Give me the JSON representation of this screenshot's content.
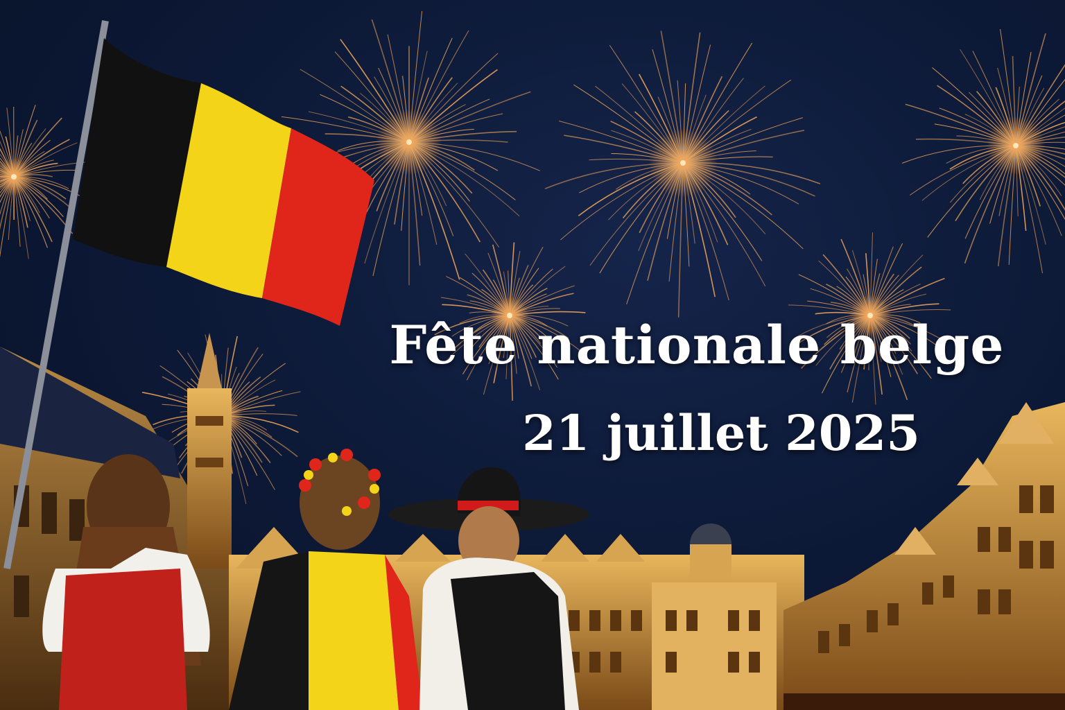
{
  "headline": {
    "title": "Fête nationale belge",
    "date": "21 juillet 2025"
  },
  "colors": {
    "sky": "#0d1a38",
    "firework": "#f2a65a",
    "flag_black": "#111111",
    "flag_yellow": "#f4d418",
    "flag_red": "#e0261b",
    "building_glow": "#d9a24a"
  },
  "icons": [
    "belgian-flag-icon",
    "firework-icon"
  ]
}
